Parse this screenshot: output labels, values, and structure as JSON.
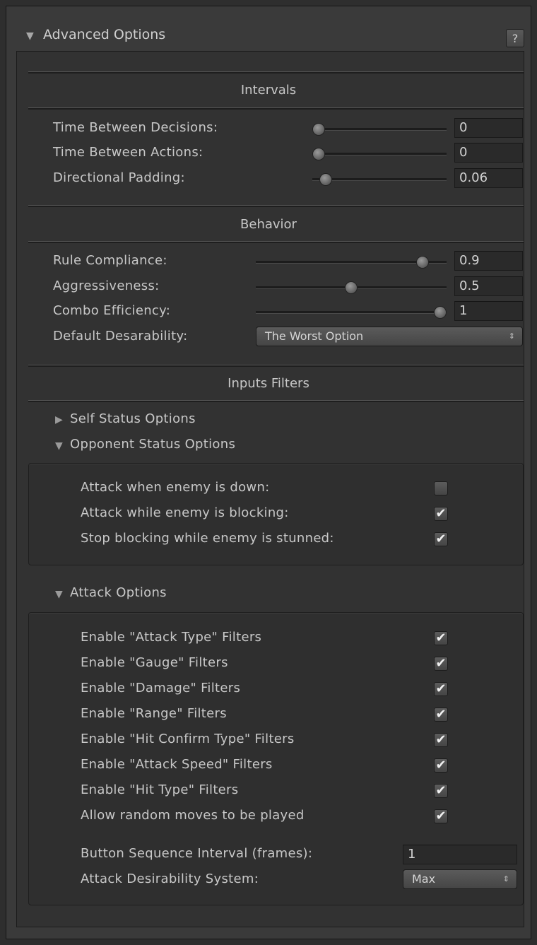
{
  "header": {
    "title": "Advanced Options",
    "help_label": "?"
  },
  "intervals": {
    "title": "Intervals",
    "rows": [
      {
        "label": "Time Between Decisions:",
        "value": "0",
        "fraction": 0.0
      },
      {
        "label": "Time Between Actions:",
        "value": "0",
        "fraction": 0.0
      },
      {
        "label": "Directional Padding:",
        "value": "0.06",
        "fraction": 0.06
      }
    ]
  },
  "behavior": {
    "title": "Behavior",
    "rows": [
      {
        "label": "Rule Compliance:",
        "value": "0.9",
        "fraction": 0.9
      },
      {
        "label": "Aggressiveness:",
        "value": "0.5",
        "fraction": 0.5
      },
      {
        "label": "Combo Efficiency:",
        "value": "1",
        "fraction": 1.0
      }
    ],
    "desirability_label": "Default Desarability:",
    "desirability_value": "The Worst Option"
  },
  "inputs_filters": {
    "title": "Inputs Filters",
    "self_status_label": "Self Status Options",
    "opponent_status_label": "Opponent Status Options",
    "opponent_options": [
      {
        "label": "Attack when enemy is down:",
        "checked": false
      },
      {
        "label": "Attack while enemy is blocking:",
        "checked": true
      },
      {
        "label": "Stop blocking while enemy is stunned:",
        "checked": true
      }
    ],
    "attack_options_label": "Attack Options",
    "attack_options": [
      {
        "label": "Enable \"Attack Type\" Filters",
        "checked": true
      },
      {
        "label": "Enable \"Gauge\" Filters",
        "checked": true
      },
      {
        "label": "Enable \"Damage\" Filters",
        "checked": true
      },
      {
        "label": "Enable \"Range\" Filters",
        "checked": true
      },
      {
        "label": "Enable \"Hit Confirm Type\" Filters",
        "checked": true
      },
      {
        "label": "Enable \"Attack Speed\" Filters",
        "checked": true
      },
      {
        "label": "Enable \"Hit Type\" Filters",
        "checked": true
      },
      {
        "label": "Allow random moves to be played",
        "checked": true
      }
    ],
    "button_sequence_label": "Button Sequence Interval (frames):",
    "button_sequence_value": "1",
    "attack_desirability_label": "Attack Desirability System:",
    "attack_desirability_value": "Max"
  },
  "icons": {
    "expanded": "▼",
    "collapsed": "▶",
    "check": "✔",
    "dropdown_arrows": "⇕"
  }
}
